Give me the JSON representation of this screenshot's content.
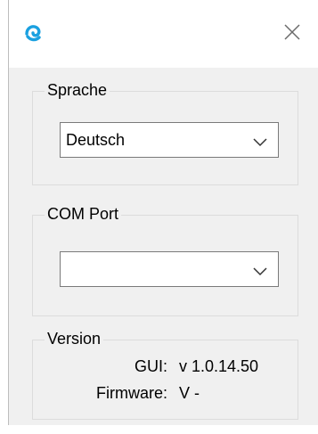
{
  "window": {
    "close_icon": "close-icon",
    "app_icon": "app-logo-icon",
    "accent_color": "#1aa0e0"
  },
  "language": {
    "legend": "Sprache",
    "selected": "Deutsch"
  },
  "com_port": {
    "legend": "COM Port",
    "selected": ""
  },
  "version": {
    "legend": "Version",
    "gui_label": "GUI:",
    "gui_value": "v 1.0.14.50",
    "firmware_label": "Firmware:",
    "firmware_value": "V -"
  }
}
